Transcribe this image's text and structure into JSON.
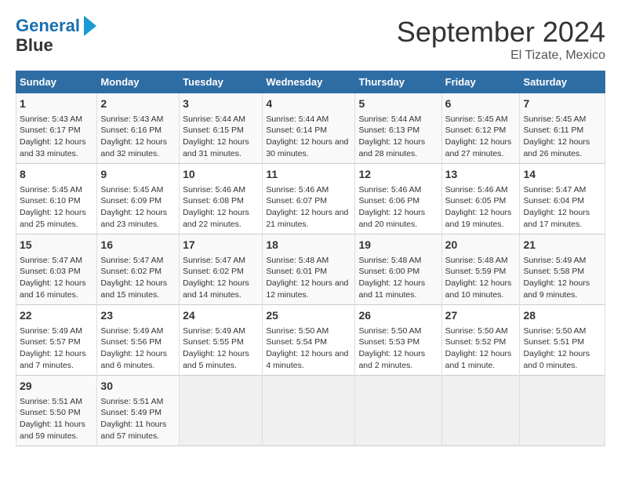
{
  "header": {
    "logo_line1": "General",
    "logo_line2": "Blue",
    "month": "September 2024",
    "location": "El Tizate, Mexico"
  },
  "days_of_week": [
    "Sunday",
    "Monday",
    "Tuesday",
    "Wednesday",
    "Thursday",
    "Friday",
    "Saturday"
  ],
  "weeks": [
    [
      {
        "day": 1,
        "sunrise": "5:43 AM",
        "sunset": "6:17 PM",
        "daylight": "12 hours and 33 minutes."
      },
      {
        "day": 2,
        "sunrise": "5:43 AM",
        "sunset": "6:16 PM",
        "daylight": "12 hours and 32 minutes."
      },
      {
        "day": 3,
        "sunrise": "5:44 AM",
        "sunset": "6:15 PM",
        "daylight": "12 hours and 31 minutes."
      },
      {
        "day": 4,
        "sunrise": "5:44 AM",
        "sunset": "6:14 PM",
        "daylight": "12 hours and 30 minutes."
      },
      {
        "day": 5,
        "sunrise": "5:44 AM",
        "sunset": "6:13 PM",
        "daylight": "12 hours and 28 minutes."
      },
      {
        "day": 6,
        "sunrise": "5:45 AM",
        "sunset": "6:12 PM",
        "daylight": "12 hours and 27 minutes."
      },
      {
        "day": 7,
        "sunrise": "5:45 AM",
        "sunset": "6:11 PM",
        "daylight": "12 hours and 26 minutes."
      }
    ],
    [
      {
        "day": 8,
        "sunrise": "5:45 AM",
        "sunset": "6:10 PM",
        "daylight": "12 hours and 25 minutes."
      },
      {
        "day": 9,
        "sunrise": "5:45 AM",
        "sunset": "6:09 PM",
        "daylight": "12 hours and 23 minutes."
      },
      {
        "day": 10,
        "sunrise": "5:46 AM",
        "sunset": "6:08 PM",
        "daylight": "12 hours and 22 minutes."
      },
      {
        "day": 11,
        "sunrise": "5:46 AM",
        "sunset": "6:07 PM",
        "daylight": "12 hours and 21 minutes."
      },
      {
        "day": 12,
        "sunrise": "5:46 AM",
        "sunset": "6:06 PM",
        "daylight": "12 hours and 20 minutes."
      },
      {
        "day": 13,
        "sunrise": "5:46 AM",
        "sunset": "6:05 PM",
        "daylight": "12 hours and 19 minutes."
      },
      {
        "day": 14,
        "sunrise": "5:47 AM",
        "sunset": "6:04 PM",
        "daylight": "12 hours and 17 minutes."
      }
    ],
    [
      {
        "day": 15,
        "sunrise": "5:47 AM",
        "sunset": "6:03 PM",
        "daylight": "12 hours and 16 minutes."
      },
      {
        "day": 16,
        "sunrise": "5:47 AM",
        "sunset": "6:02 PM",
        "daylight": "12 hours and 15 minutes."
      },
      {
        "day": 17,
        "sunrise": "5:47 AM",
        "sunset": "6:02 PM",
        "daylight": "12 hours and 14 minutes."
      },
      {
        "day": 18,
        "sunrise": "5:48 AM",
        "sunset": "6:01 PM",
        "daylight": "12 hours and 12 minutes."
      },
      {
        "day": 19,
        "sunrise": "5:48 AM",
        "sunset": "6:00 PM",
        "daylight": "12 hours and 11 minutes."
      },
      {
        "day": 20,
        "sunrise": "5:48 AM",
        "sunset": "5:59 PM",
        "daylight": "12 hours and 10 minutes."
      },
      {
        "day": 21,
        "sunrise": "5:49 AM",
        "sunset": "5:58 PM",
        "daylight": "12 hours and 9 minutes."
      }
    ],
    [
      {
        "day": 22,
        "sunrise": "5:49 AM",
        "sunset": "5:57 PM",
        "daylight": "12 hours and 7 minutes."
      },
      {
        "day": 23,
        "sunrise": "5:49 AM",
        "sunset": "5:56 PM",
        "daylight": "12 hours and 6 minutes."
      },
      {
        "day": 24,
        "sunrise": "5:49 AM",
        "sunset": "5:55 PM",
        "daylight": "12 hours and 5 minutes."
      },
      {
        "day": 25,
        "sunrise": "5:50 AM",
        "sunset": "5:54 PM",
        "daylight": "12 hours and 4 minutes."
      },
      {
        "day": 26,
        "sunrise": "5:50 AM",
        "sunset": "5:53 PM",
        "daylight": "12 hours and 2 minutes."
      },
      {
        "day": 27,
        "sunrise": "5:50 AM",
        "sunset": "5:52 PM",
        "daylight": "12 hours and 1 minute."
      },
      {
        "day": 28,
        "sunrise": "5:50 AM",
        "sunset": "5:51 PM",
        "daylight": "12 hours and 0 minutes."
      }
    ],
    [
      {
        "day": 29,
        "sunrise": "5:51 AM",
        "sunset": "5:50 PM",
        "daylight": "11 hours and 59 minutes."
      },
      {
        "day": 30,
        "sunrise": "5:51 AM",
        "sunset": "5:49 PM",
        "daylight": "11 hours and 57 minutes."
      },
      null,
      null,
      null,
      null,
      null
    ]
  ]
}
